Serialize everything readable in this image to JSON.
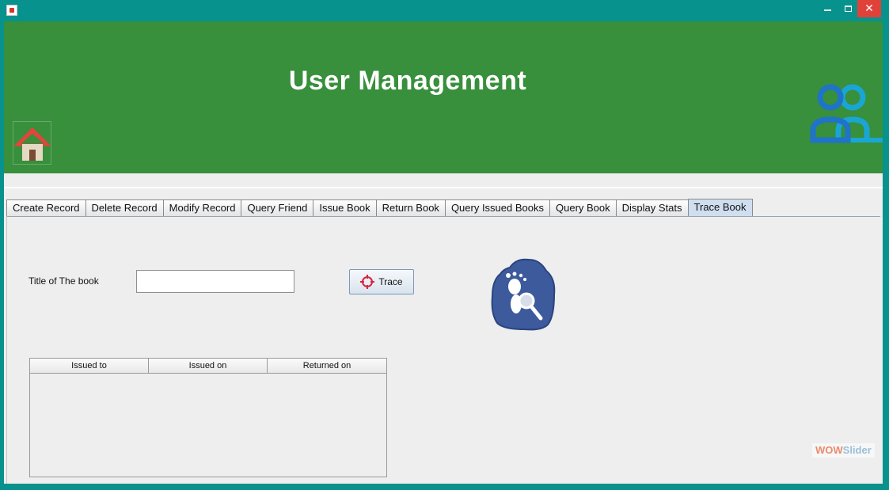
{
  "window": {
    "controls": {
      "minimize": "minimize",
      "maximize": "maximize",
      "close": "✕"
    }
  },
  "header": {
    "title": "User Management",
    "colors": {
      "banner": "#388f3c",
      "users_icon_primary": "#1f73c9",
      "users_icon_secondary": "#1aa6d4"
    }
  },
  "tabs": [
    {
      "label": "Create Record"
    },
    {
      "label": "Delete Record"
    },
    {
      "label": "Modify Record"
    },
    {
      "label": "Query Friend"
    },
    {
      "label": "Issue Book"
    },
    {
      "label": "Return Book"
    },
    {
      "label": "Query Issued Books"
    },
    {
      "label": "Query Book"
    },
    {
      "label": "Display Stats"
    },
    {
      "label": "Trace Book",
      "active": true
    }
  ],
  "form": {
    "title_label": "Title of The book",
    "title_value": "",
    "trace_button": "Trace"
  },
  "table": {
    "columns": [
      "Issued to",
      "Issued on",
      "Returned on"
    ],
    "rows": []
  },
  "watermark": {
    "part1": "WOW",
    "part2": "Slider"
  }
}
